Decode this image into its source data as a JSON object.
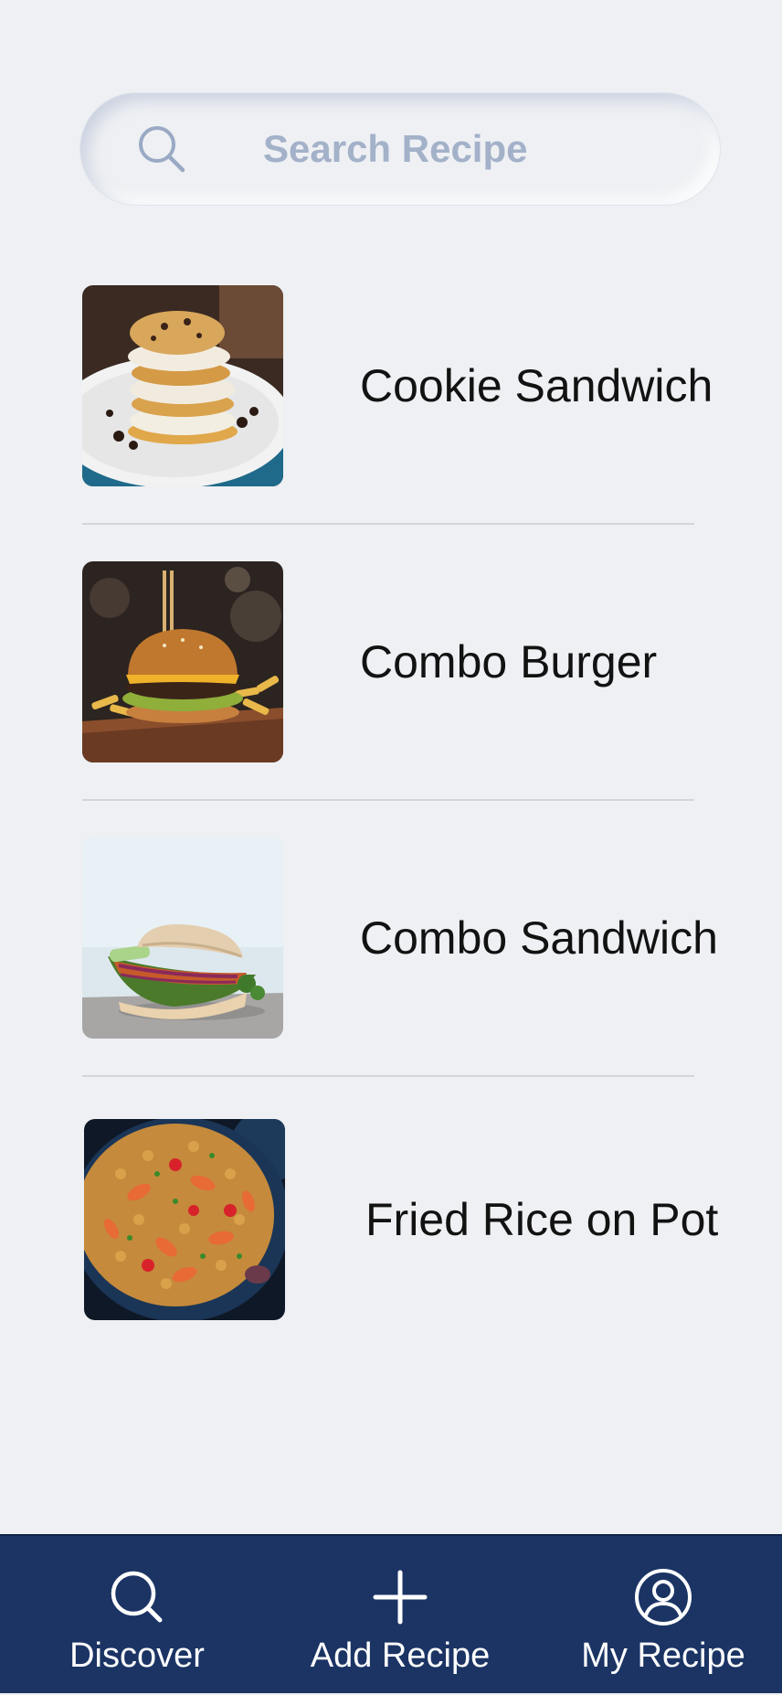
{
  "search": {
    "placeholder": "Search Recipe",
    "icon": "search-icon"
  },
  "recipes": [
    {
      "title": "Cookie Sandwich",
      "image": "cookie-sandwich-photo"
    },
    {
      "title": "Combo Burger",
      "image": "combo-burger-photo"
    },
    {
      "title": "Combo Sandwich",
      "image": "combo-sandwich-photo"
    },
    {
      "title": "Fried Rice on Pot",
      "image": "fried-rice-pot-photo"
    }
  ],
  "bottom_nav": {
    "items": [
      {
        "label": "Discover",
        "icon": "search-icon"
      },
      {
        "label": "Add Recipe",
        "icon": "plus-icon"
      },
      {
        "label": "My Recipe",
        "icon": "user-circle-icon"
      }
    ]
  },
  "colors": {
    "background": "#eef0f3",
    "nav_background": "#1b3464",
    "placeholder": "#a3b1c9",
    "title_text": "#121212"
  }
}
